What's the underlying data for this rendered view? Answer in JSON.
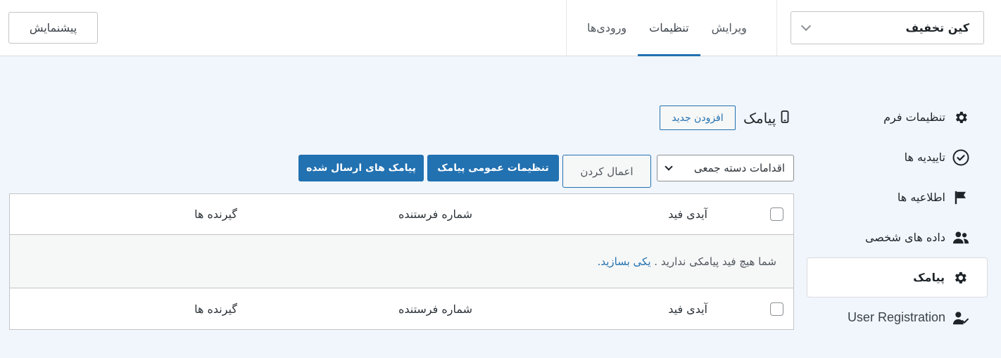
{
  "header": {
    "preview_label": "پیشنمایش",
    "tabs": [
      {
        "label": "ویرایش",
        "active": false
      },
      {
        "label": "تنظیمات",
        "active": true
      },
      {
        "label": "ورودی‌ها",
        "active": false
      }
    ],
    "form_select": {
      "value": "کین تخفیف"
    }
  },
  "sidebar": {
    "items": [
      {
        "label": "تنظیمات فرم",
        "icon": "gear-icon",
        "active": false
      },
      {
        "label": "تاییدیه ها",
        "icon": "check-circle-icon",
        "active": false
      },
      {
        "label": "اطلاعیه ها",
        "icon": "flag-icon",
        "active": false
      },
      {
        "label": "داده های شخصی",
        "icon": "users-icon",
        "active": false
      },
      {
        "label": "پیامک",
        "icon": "gear-icon",
        "active": true
      },
      {
        "label": "User Registration",
        "icon": "user-check-icon",
        "active": false
      }
    ]
  },
  "main": {
    "title": "پیامک",
    "title_icon": "mobile-icon",
    "add_new_label": "افزودن جدید",
    "bulk_actions": {
      "selected": "اقدامات دسته جمعی"
    },
    "apply_label": "اعمال کردن",
    "general_settings_label": "تنظیمات عمومی پیامک",
    "sent_sms_label": "پیامک های ارسال شده",
    "table": {
      "columns": [
        "آیدی فید",
        "شماره فرستنده",
        "گیرنده ها"
      ],
      "empty_text": "شما هیچ فید پیامکی ندارید .",
      "empty_link": "یکی بسازید."
    }
  },
  "colors": {
    "accent": "#2271b1",
    "background": "#f0f6fc",
    "border": "#c3c4c7"
  }
}
